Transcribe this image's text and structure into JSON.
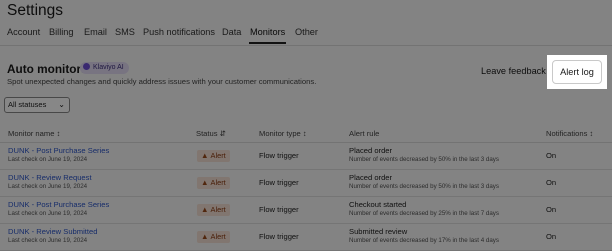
{
  "page_title": "Settings",
  "tabs": [
    {
      "label": "Account"
    },
    {
      "label": "Billing"
    },
    {
      "label": "Email"
    },
    {
      "label": "SMS"
    },
    {
      "label": "Push notifications"
    },
    {
      "label": "Data"
    },
    {
      "label": "Monitors",
      "active": true
    },
    {
      "label": "Other"
    }
  ],
  "section": {
    "title": "Auto monitors",
    "badge": "Klaviyo AI",
    "subtitle": "Spot unexpected changes and quickly address issues with your customer communications.",
    "feedback_label": "Leave feedback",
    "alert_log_label": "Alert log"
  },
  "filter": {
    "value": "All statuses"
  },
  "table": {
    "headers": {
      "name": "Monitor name",
      "status": "Status",
      "type": "Monitor type",
      "rule": "Alert rule",
      "notifications": "Notifications"
    },
    "rows": [
      {
        "name": "DUNK - Post Purchase Series",
        "last_check": "Last check on June 19, 2024",
        "status": "Alert",
        "type": "Flow trigger",
        "rule": "Placed order",
        "detail": "Number of events decreased by 50% in the last 3 days",
        "notifications": "On"
      },
      {
        "name": "DUNK - Review Request",
        "last_check": "Last check on June 19, 2024",
        "status": "Alert",
        "type": "Flow trigger",
        "rule": "Placed order",
        "detail": "Number of events decreased by 50% in the last 3 days",
        "notifications": "On"
      },
      {
        "name": "DUNK - Post Purchase Series",
        "last_check": "Last check on June 19, 2024",
        "status": "Alert",
        "type": "Flow trigger",
        "rule": "Checkout started",
        "detail": "Number of events decreased by 25% in the last 7 days",
        "notifications": "On"
      },
      {
        "name": "DUNK - Review Submitted",
        "last_check": "Last check on June 19, 2024",
        "status": "Alert",
        "type": "Flow trigger",
        "rule": "Submitted review",
        "detail": "Number of events decreased by 17% in the last 4 days",
        "notifications": "On"
      }
    ]
  },
  "colors": {
    "accent_link": "#2c55c8",
    "alert_bg": "#f3dfd3",
    "badge_bg": "#e2dcf4"
  },
  "icons": {
    "status_alert": "warning-triangle-icon",
    "sort": "sort-icon",
    "dropdown": "chevron-down-icon"
  }
}
